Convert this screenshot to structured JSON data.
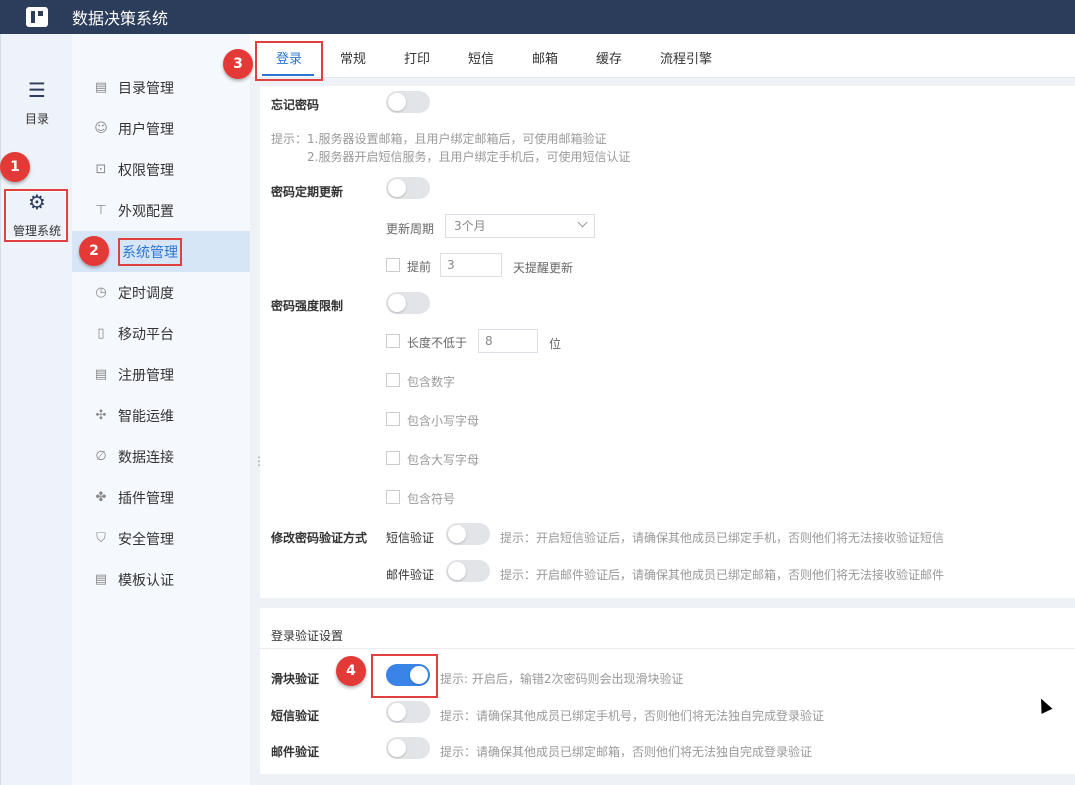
{
  "header": {
    "title": "数据决策系统"
  },
  "rail": [
    {
      "label": "目录",
      "icon": "list-icon"
    },
    {
      "label": "管理系统",
      "icon": "gear-icon"
    }
  ],
  "subnav": [
    {
      "label": "目录管理",
      "icon": "catalog-icon"
    },
    {
      "label": "用户管理",
      "icon": "user-icon"
    },
    {
      "label": "权限管理",
      "icon": "lock-icon"
    },
    {
      "label": "外观配置",
      "icon": "paint-roller-icon"
    },
    {
      "label": "系统管理",
      "icon": "monitor-icon"
    },
    {
      "label": "定时调度",
      "icon": "timer-icon"
    },
    {
      "label": "移动平台",
      "icon": "mobile-icon"
    },
    {
      "label": "注册管理",
      "icon": "register-icon"
    },
    {
      "label": "智能运维",
      "icon": "network-icon"
    },
    {
      "label": "数据连接",
      "icon": "paperclip-icon"
    },
    {
      "label": "插件管理",
      "icon": "puzzle-icon"
    },
    {
      "label": "安全管理",
      "icon": "shield-icon"
    },
    {
      "label": "模板认证",
      "icon": "template-icon"
    }
  ],
  "badges": [
    "1",
    "2",
    "3",
    "4"
  ],
  "tabs": [
    "登录",
    "常规",
    "打印",
    "短信",
    "邮箱",
    "缓存",
    "流程引擎"
  ],
  "forgot": {
    "label": "忘记密码",
    "hint1": "提示：1.服务器设置邮箱，且用户绑定邮箱后，可使用邮箱验证",
    "hint2": "2.服务器开启短信服务，且用户绑定手机后，可使用短信认证"
  },
  "expire": {
    "label": "密码定期更新",
    "period_label": "更新周期",
    "period_value": "3个月",
    "advance_label": "提前",
    "advance_value": "3",
    "advance_suffix": "天提醒更新"
  },
  "strength": {
    "label": "密码强度限制",
    "length_label": "长度不低于",
    "length_value": "8",
    "length_unit": "位",
    "digits": "包含数字",
    "lower": "包含小写字母",
    "upper": "包含大写字母",
    "symbol": "包含符号"
  },
  "modify": {
    "label": "修改密码验证方式",
    "sms_label": "短信验证",
    "sms_hint": "提示：开启短信验证后，请确保其他成员已绑定手机，否则他们将无法接收验证短信",
    "mail_label": "邮件验证",
    "mail_hint": "提示：开启邮件验证后，请确保其他成员已绑定邮箱，否则他们将无法接收验证邮件"
  },
  "login_verify": {
    "title": "登录验证设置",
    "slider_label": "滑块验证",
    "slider_hint": "提示: 开启后，输错2次密码则会出现滑块验证",
    "sms_label": "短信验证",
    "sms_hint": "提示：请确保其他成员已绑定手机号，否则他们将无法独自完成登录验证",
    "mail_label": "邮件验证",
    "mail_hint": "提示：请确保其他成员已绑定邮箱，否则他们将无法独自完成登录验证"
  }
}
